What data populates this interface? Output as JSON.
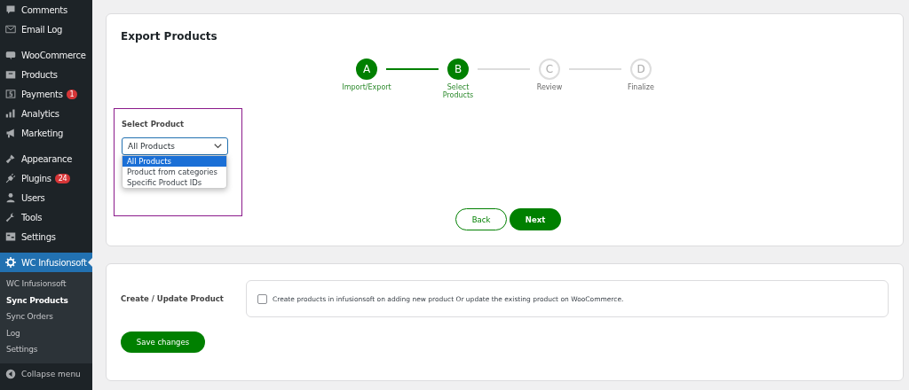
{
  "sidebar": {
    "groups": [
      {
        "items": [
          {
            "label": "Comments",
            "selected": false
          },
          {
            "label": "Email Log",
            "selected": false
          }
        ]
      },
      {
        "items": [
          {
            "label": "WooCommerce",
            "selected": false
          },
          {
            "label": "Products",
            "selected": false
          },
          {
            "label": "Payments",
            "badge": "1",
            "selected": false
          },
          {
            "label": "Analytics",
            "selected": false
          },
          {
            "label": "Marketing",
            "selected": false
          }
        ]
      },
      {
        "items": [
          {
            "label": "Appearance",
            "selected": false
          },
          {
            "label": "Plugins",
            "badge": "24",
            "selected": false
          },
          {
            "label": "Users",
            "selected": false
          },
          {
            "label": "Tools",
            "selected": false
          },
          {
            "label": "Settings",
            "selected": false
          }
        ]
      },
      {
        "items": [
          {
            "label": "WC Infusionsoft",
            "selected": true
          }
        ]
      }
    ],
    "submenu": [
      {
        "label": "WC Infusionsoft",
        "selected": false
      },
      {
        "label": "Sync Products",
        "selected": true
      },
      {
        "label": "Sync Orders",
        "selected": false
      },
      {
        "label": "Log",
        "selected": false
      },
      {
        "label": "Settings",
        "selected": false
      }
    ],
    "collapse": "Collapse menu"
  },
  "export": {
    "title": "Export Products",
    "steps": [
      {
        "letter": "A",
        "label": "Import/Export",
        "completed": true
      },
      {
        "letter": "B",
        "label": "Select Products",
        "completed": true
      },
      {
        "letter": "C",
        "label": "Review",
        "completed": false
      },
      {
        "letter": "D",
        "label": "Finalize",
        "completed": false
      }
    ],
    "select": {
      "label": "Select Product",
      "value": "All Products",
      "options": [
        {
          "label": "All Products",
          "selected": true
        },
        {
          "label": "Product from categories",
          "selected": false
        },
        {
          "label": "Specific Product IDs",
          "selected": false
        }
      ]
    },
    "buttons": {
      "back": "Back",
      "next": "Next"
    }
  },
  "settings": {
    "label": "Create / Update Product",
    "checkbox": {
      "label": "Create products in infusionsoft on adding new product Or update the existing product on WooCommerce.",
      "checked": false
    },
    "save": "Save changes"
  }
}
